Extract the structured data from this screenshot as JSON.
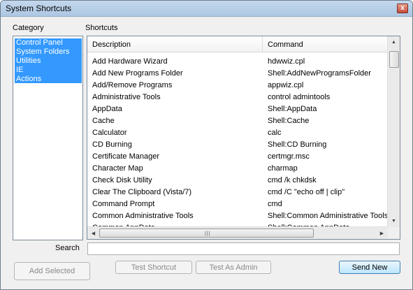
{
  "window": {
    "title": "System Shortcuts",
    "close_label": "x"
  },
  "category": {
    "label": "Category",
    "items": [
      "Control Panel",
      "System Folders",
      "Utilities",
      "IE",
      "Actions"
    ]
  },
  "shortcuts": {
    "label": "Shortcuts",
    "columns": [
      "Description",
      "Command"
    ],
    "rows": [
      [
        "Add Hardware Wizard",
        "hdwwiz.cpl"
      ],
      [
        "Add New Programs Folder",
        "Shell:AddNewProgramsFolder"
      ],
      [
        "Add/Remove Programs",
        "appwiz.cpl"
      ],
      [
        "Administrative Tools",
        "control admintools"
      ],
      [
        "AppData",
        "Shell:AppData"
      ],
      [
        "Cache",
        "Shell:Cache"
      ],
      [
        "Calculator",
        "calc"
      ],
      [
        "CD Burning",
        "Shell:CD Burning"
      ],
      [
        "Certificate Manager",
        "certmgr.msc"
      ],
      [
        "Character Map",
        "charmap"
      ],
      [
        "Check Disk Utility",
        "cmd /k chkdsk"
      ],
      [
        "Clear The Clipboard (Vista/7)",
        "cmd /C \"echo off | clip\""
      ],
      [
        "Command Prompt",
        "cmd"
      ],
      [
        "Common Administrative Tools",
        "Shell:Common Administrative Tools"
      ],
      [
        "Common AppData",
        "Shell:Common AppData"
      ]
    ]
  },
  "search": {
    "label": "Search",
    "value": "",
    "placeholder": ""
  },
  "buttons": {
    "add_selected": "Add Selected",
    "test_shortcut": "Test Shortcut",
    "test_as_admin": "Test As Admin",
    "send_new": "Send New"
  },
  "colors": {
    "selection": "#3399ff",
    "titlebar": "#c4d8ed"
  }
}
